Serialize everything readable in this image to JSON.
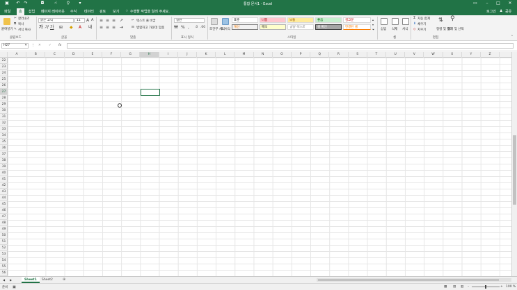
{
  "window": {
    "title": "통합 문서1 - Excel",
    "user": "로그인",
    "share": "공유"
  },
  "tabs": [
    "파일",
    "홈",
    "삽입",
    "페이지 레이아웃",
    "수식",
    "데이터",
    "검토",
    "보기"
  ],
  "active_tab": "홈",
  "tell_me": "수행할 작업을 알려 주세요.",
  "ribbon": {
    "clipboard": {
      "paste": "붙여넣기",
      "cut": "잘라내기",
      "copy": "복사",
      "format_painter": "서식 복사",
      "label": "클립보드"
    },
    "font": {
      "name": "맑은 고딕",
      "size": "11",
      "label": "글꼴"
    },
    "alignment": {
      "wrap": "텍스트 줄 바꿈",
      "merge": "병합하고 가운데 맞춤",
      "label": "맞춤"
    },
    "number": {
      "format": "일반",
      "label": "표시 형식"
    },
    "styles": {
      "conditional": "조건부 서식",
      "table": "표 서식",
      "items": [
        "표준",
        "나쁨",
        "보통",
        "좋음",
        "경고문",
        "계산",
        "메모",
        "설명 텍스트",
        "셀 확인",
        "연결된 셀"
      ],
      "label": "스타일"
    },
    "cells": {
      "insert": "삽입",
      "delete": "삭제",
      "format": "서식",
      "label": "셀"
    },
    "editing": {
      "autosum": "자동 합계",
      "fill": "채우기",
      "clear": "지우기",
      "sort": "정렬 및 필터",
      "find": "찾기 및 선택",
      "label": "편집"
    }
  },
  "formula_bar": {
    "name_box": "H27",
    "fx": "fx",
    "value": ""
  },
  "columns": [
    "A",
    "B",
    "C",
    "D",
    "E",
    "F",
    "G",
    "H",
    "I",
    "J",
    "K",
    "L",
    "M",
    "N",
    "O",
    "P",
    "Q",
    "R",
    "S",
    "T",
    "U",
    "V",
    "W",
    "X",
    "Y",
    "Z"
  ],
  "rows": [
    "22",
    "23",
    "24",
    "25",
    "26",
    "27",
    "28",
    "29",
    "30",
    "31",
    "32",
    "33",
    "34",
    "35",
    "36",
    "37",
    "38",
    "39",
    "40",
    "41",
    "42",
    "43",
    "44",
    "45",
    "46",
    "47",
    "48",
    "49",
    "50",
    "51",
    "52",
    "53",
    "54",
    "55",
    "56"
  ],
  "selected_cell": {
    "col": "H",
    "row": "27"
  },
  "sheets": [
    "Sheet1",
    "Sheet2"
  ],
  "active_sheet": "Sheet1",
  "status": {
    "ready": "준비",
    "zoom": "100 %"
  },
  "colors": {
    "accent": "#217346"
  }
}
